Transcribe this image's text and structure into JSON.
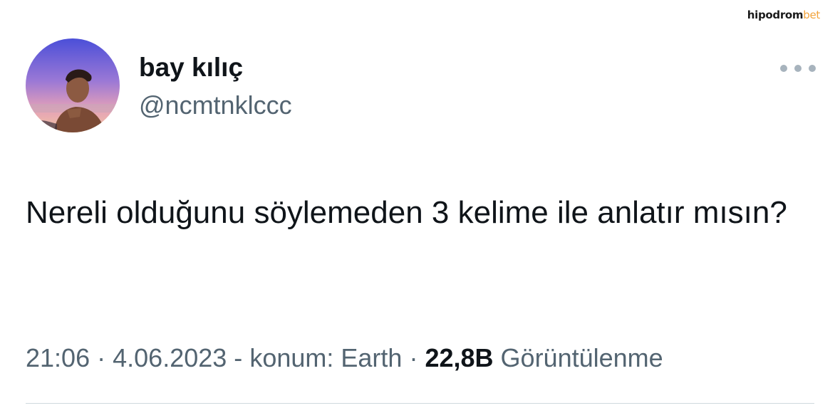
{
  "watermark": {
    "part_a": "hipodrom",
    "part_b": "bet"
  },
  "author": {
    "display_name": "bay kılıç",
    "handle": "@ncmtnklccc",
    "avatar_icon": "profile-photo"
  },
  "more_icon": "more-options-icon",
  "tweet": {
    "text": "Nereli olduğunu söylemeden 3 kelime ile anlatır mısın?"
  },
  "meta": {
    "time": "21:06",
    "separator": "·",
    "date": "4.06.2023",
    "dash": "-",
    "location": "konum: Earth",
    "views_count": "22,8B",
    "views_label": "Görüntülenme"
  },
  "colors": {
    "text_primary": "#0f1419",
    "text_secondary": "#536471",
    "divider": "#cfd9de",
    "watermark_accent": "#f2a33a"
  }
}
